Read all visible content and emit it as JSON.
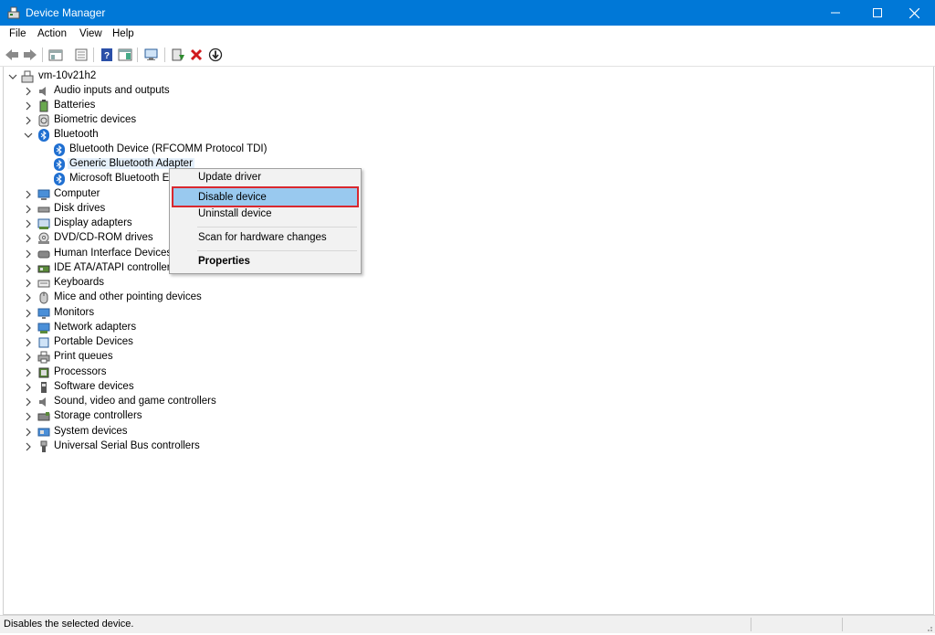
{
  "window": {
    "title": "Device Manager",
    "minimize_glyph": "—",
    "maximize_glyph": "☐",
    "close_glyph": "✕"
  },
  "menu": [
    "File",
    "Action",
    "View",
    "Help"
  ],
  "toolbar": {
    "icons": [
      "back-icon",
      "forward-icon",
      "properties-sheet-icon",
      "show-hide-console-tree-icon",
      "help-icon",
      "action-pane-icon",
      "scan-hardware-icon",
      "update-driver-icon",
      "uninstall-icon",
      "disable-device-icon"
    ]
  },
  "tree": {
    "root": "vm-10v21h2",
    "categories": [
      {
        "label": "Audio inputs and outputs",
        "icon": "speaker-icon"
      },
      {
        "label": "Batteries",
        "icon": "battery-icon"
      },
      {
        "label": "Biometric devices",
        "icon": "fingerprint-icon"
      },
      {
        "label": "Bluetooth",
        "icon": "bluetooth-icon"
      },
      {
        "label": "Computer",
        "icon": "computer-icon"
      },
      {
        "label": "Disk drives",
        "icon": "disk-drive-icon"
      },
      {
        "label": "Display adapters",
        "icon": "display-adapter-icon"
      },
      {
        "label": "DVD/CD-ROM drives",
        "icon": "dvd-drive-icon"
      },
      {
        "label": "Human Interface Devices",
        "icon": "hid-icon"
      },
      {
        "label": "IDE ATA/ATAPI controllers",
        "icon": "ide-controller-icon"
      },
      {
        "label": "Keyboards",
        "icon": "keyboard-icon"
      },
      {
        "label": "Mice and other pointing devices",
        "icon": "mouse-icon"
      },
      {
        "label": "Monitors",
        "icon": "monitor-icon"
      },
      {
        "label": "Network adapters",
        "icon": "network-adapter-icon"
      },
      {
        "label": "Portable Devices",
        "icon": "portable-device-icon"
      },
      {
        "label": "Print queues",
        "icon": "printer-icon"
      },
      {
        "label": "Processors",
        "icon": "processor-icon"
      },
      {
        "label": "Software devices",
        "icon": "software-device-icon"
      },
      {
        "label": "Sound, video and game controllers",
        "icon": "sound-controller-icon"
      },
      {
        "label": "Storage controllers",
        "icon": "storage-controller-icon"
      },
      {
        "label": "System devices",
        "icon": "system-device-icon"
      },
      {
        "label": "Universal Serial Bus controllers",
        "icon": "usb-icon"
      }
    ],
    "bluetooth_children": [
      "Bluetooth Device (RFCOMM Protocol TDI)",
      "Generic Bluetooth Adapter",
      "Microsoft Bluetooth En"
    ]
  },
  "context_menu": {
    "update": "Update driver",
    "disable": "Disable device",
    "uninstall": "Uninstall device",
    "scan": "Scan for hardware changes",
    "properties": "Properties"
  },
  "status": {
    "text": "Disables the selected device."
  },
  "colors": {
    "titlebar": "#0078d7",
    "highlight": "#99c9ef",
    "annotation_border": "#d9282f"
  }
}
